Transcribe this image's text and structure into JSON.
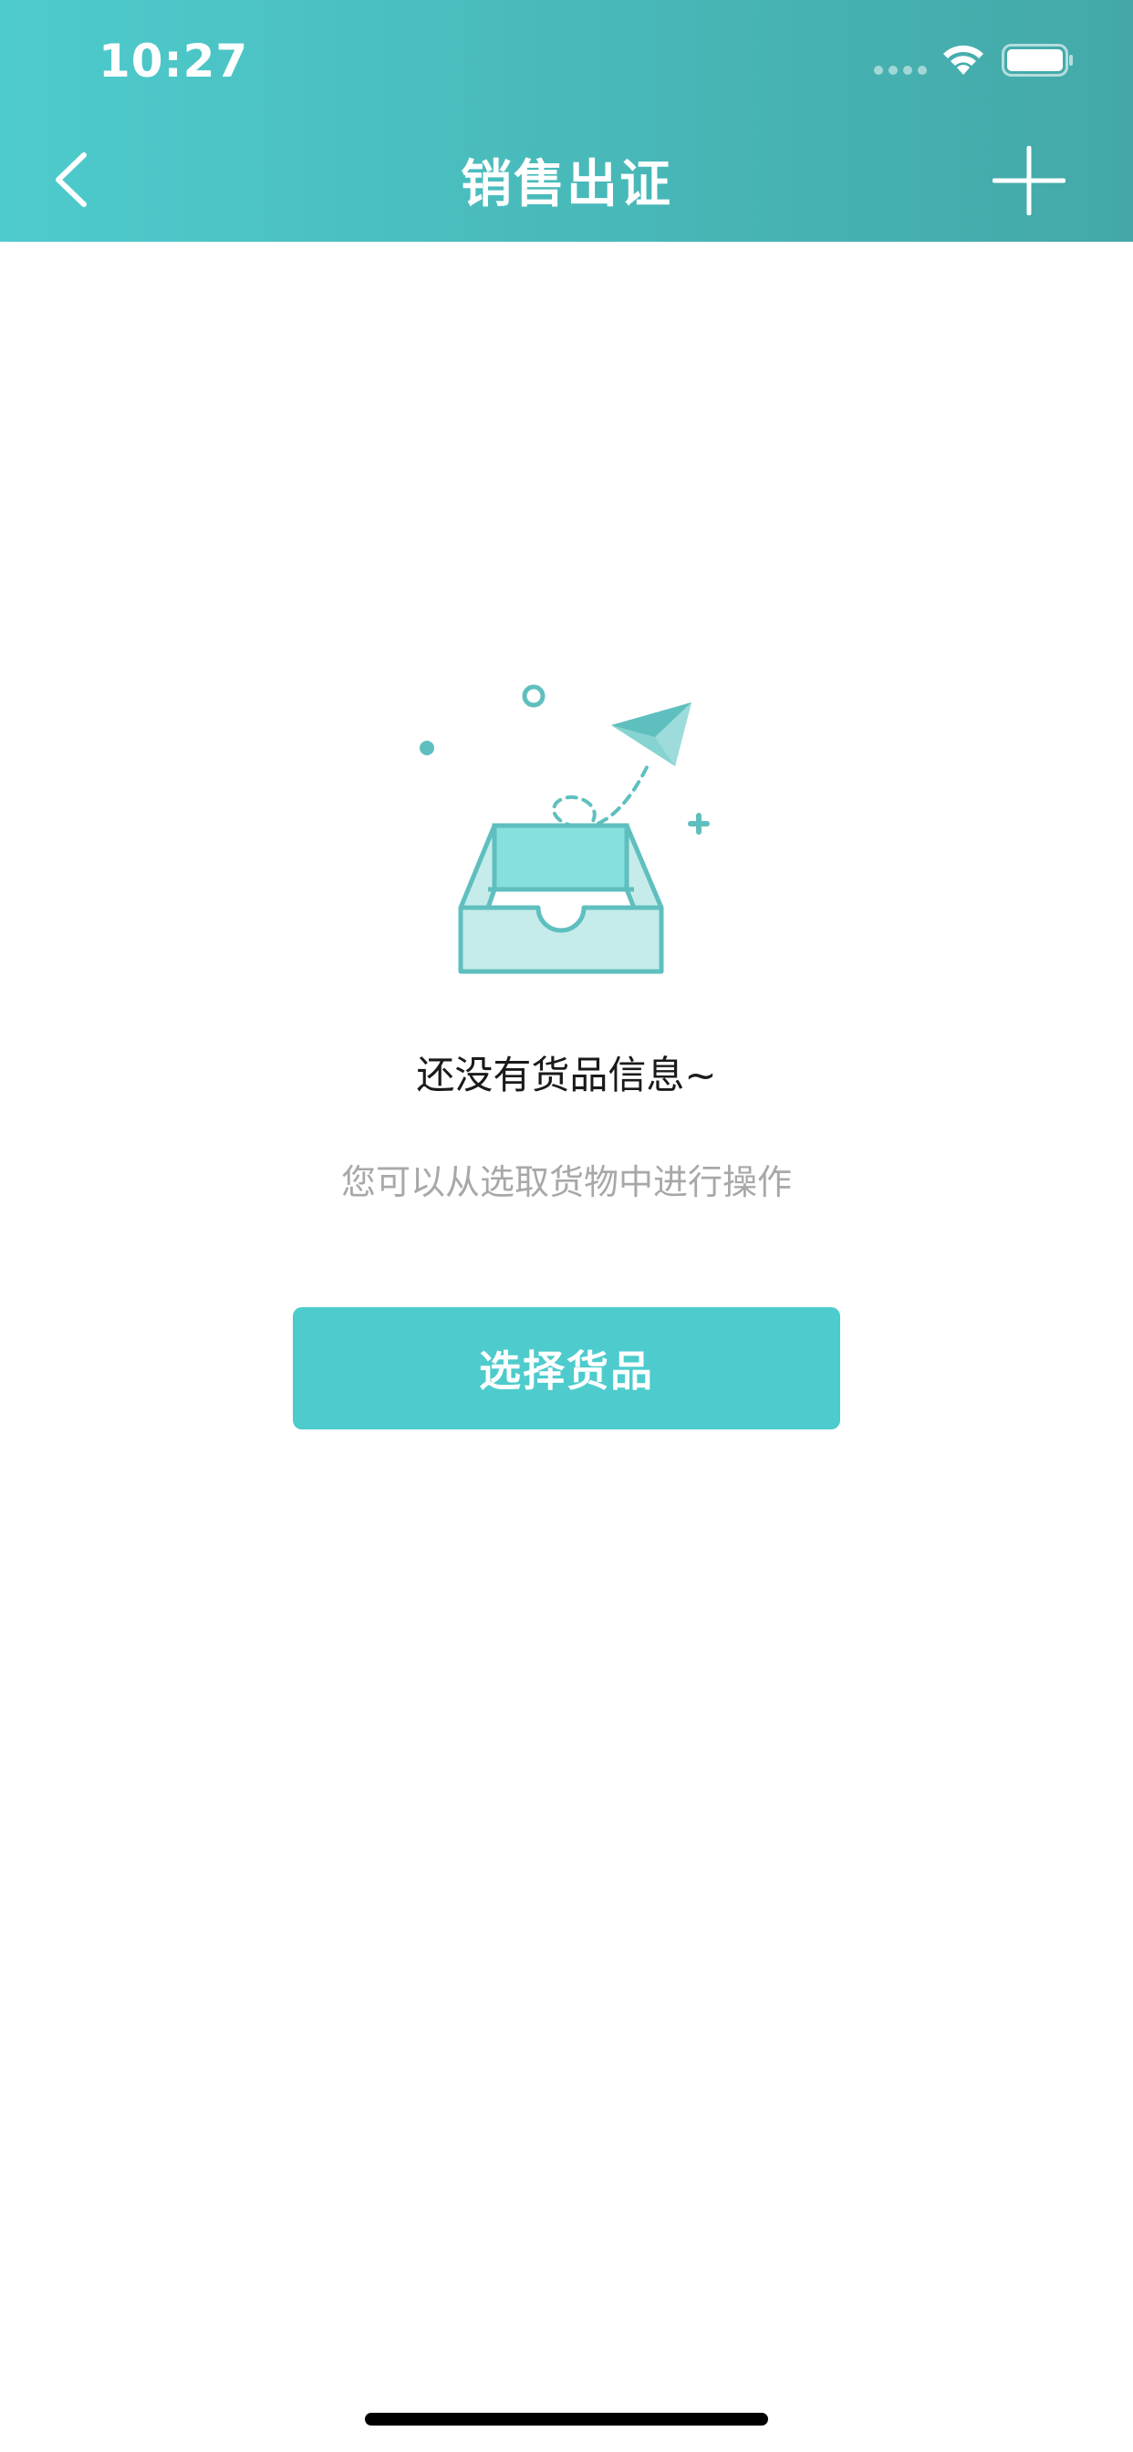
{
  "status_bar": {
    "time": "10:27"
  },
  "nav": {
    "title": "销售出证",
    "back_icon": "chevron-left-icon",
    "add_icon": "plus-icon"
  },
  "empty_state": {
    "title": "还没有货品信息~",
    "subtitle": "您可以从选取货物中进行操作",
    "illustration": "empty-inbox-paper-plane-icon"
  },
  "actions": {
    "select_goods_label": "选择货品"
  },
  "colors": {
    "header_start": "#4ecbcd",
    "header_end": "#44a8a8",
    "accent": "#4ecbcd",
    "illustration_stroke": "#5fbfbf",
    "illustration_fill_dark": "#86e0de",
    "illustration_fill_light": "#c5ecea",
    "subtitle_text": "#a8a8a8"
  }
}
